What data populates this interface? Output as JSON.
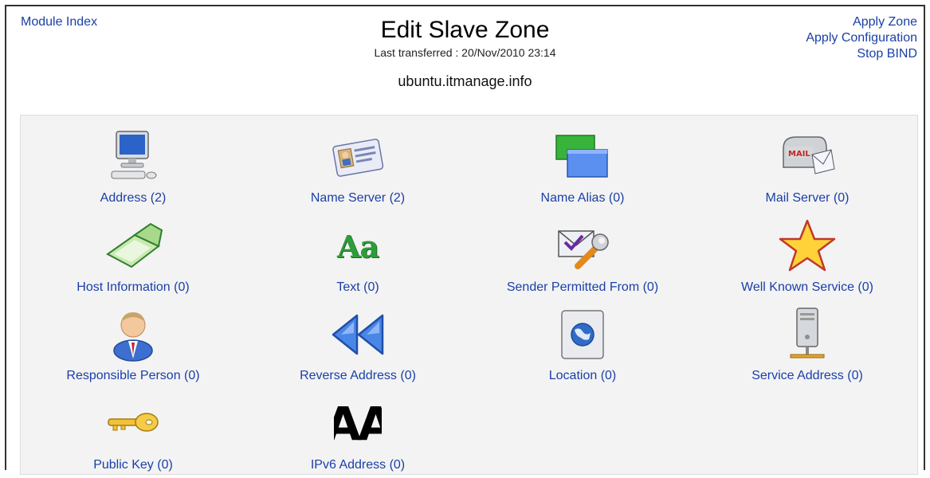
{
  "header": {
    "module_index": "Module Index",
    "title": "Edit Slave Zone",
    "last_transferred": "Last transferred : 20/Nov/2010 23:14",
    "zone_name": "ubuntu.itmanage.info",
    "right_links": [
      "Apply Zone",
      "Apply Configuration",
      "Stop BIND"
    ]
  },
  "records": [
    {
      "label": "Address (2)",
      "icon": "computer-icon"
    },
    {
      "label": "Name Server (2)",
      "icon": "id-card-icon"
    },
    {
      "label": "Name Alias (0)",
      "icon": "windows-icon"
    },
    {
      "label": "Mail Server (0)",
      "icon": "mailbox-icon"
    },
    {
      "label": "Host Information (0)",
      "icon": "laptop-icon"
    },
    {
      "label": "Text (0)",
      "icon": "text-aa-icon",
      "icon_text": "Aa"
    },
    {
      "label": "Sender Permitted From (0)",
      "icon": "mail-wrench-icon"
    },
    {
      "label": "Well Known Service (0)",
      "icon": "star-icon"
    },
    {
      "label": "Responsible Person (0)",
      "icon": "person-icon"
    },
    {
      "label": "Reverse Address (0)",
      "icon": "rewind-icon"
    },
    {
      "label": "Location (0)",
      "icon": "globe-icon"
    },
    {
      "label": "Service Address (0)",
      "icon": "server-icon"
    },
    {
      "label": "Public Key (0)",
      "icon": "key-icon"
    },
    {
      "label": "IPv6 Address (0)",
      "icon": "ipv6-aa-icon",
      "icon_text": "AA"
    }
  ],
  "colors": {
    "link": "#1a3fa8",
    "panel_bg": "#f3f3f3"
  }
}
